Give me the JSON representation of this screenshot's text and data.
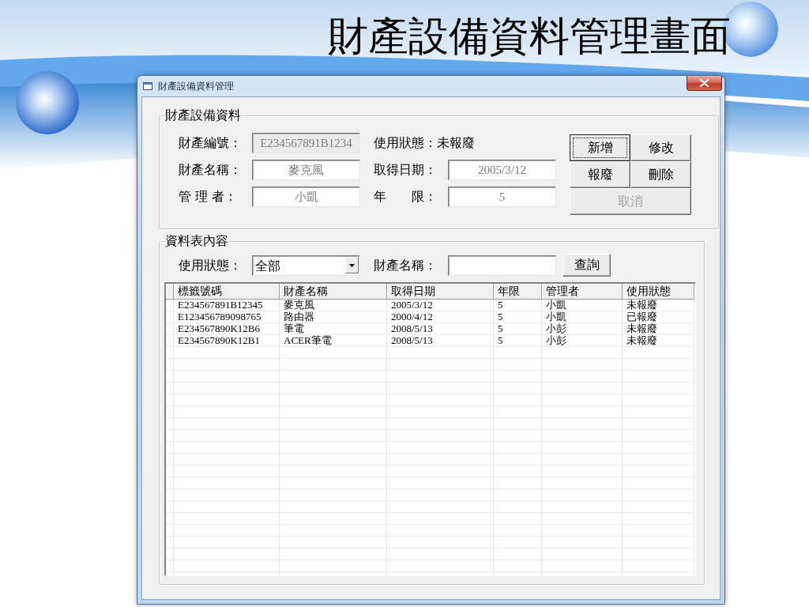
{
  "slide": {
    "title": "財產設備資料管理畫面"
  },
  "window": {
    "title": "財產設備資料管理"
  },
  "detail_group": {
    "title": "財產設備資料",
    "fields": [
      {
        "kind": "input",
        "label": "財產編號：",
        "value": "E234567891B1234",
        "disabled": true
      },
      {
        "kind": "text",
        "label": "使用狀態：",
        "value": "未報廢"
      },
      {
        "kind": "input",
        "label": "財產名稱：",
        "value": "麥克風",
        "disabled": false
      },
      {
        "kind": "input",
        "label": "取得日期：",
        "value": "2005/3/12",
        "disabled": false
      },
      {
        "kind": "input",
        "label": "管 理 者：",
        "value": "小凱",
        "disabled": false
      },
      {
        "kind": "input",
        "label": "年　　限：",
        "value": "5",
        "disabled": false
      }
    ],
    "buttons": [
      {
        "label": "新增",
        "focused": true,
        "disabled": false
      },
      {
        "label": "修改",
        "focused": false,
        "disabled": false
      },
      {
        "label": "報廢",
        "focused": false,
        "disabled": false
      },
      {
        "label": "刪除",
        "focused": false,
        "disabled": false
      },
      {
        "label": "取消",
        "focused": false,
        "disabled": true
      }
    ]
  },
  "table_group": {
    "title": "資料表內容",
    "filter": {
      "status_label": "使用狀態：",
      "status_value": "全部",
      "name_label": "財產名稱：",
      "search_button": "查詢"
    },
    "table": {
      "columns": [
        "標籤號碼",
        "財產名稱",
        "取得日期",
        "年限",
        "管理者",
        "使用狀態"
      ],
      "rows": [
        [
          "E234567891B12345",
          "麥克風",
          "2005/3/12",
          "5",
          "小凱",
          "未報廢"
        ],
        [
          "E123456789098765",
          "路由器",
          "2000/4/12",
          "5",
          "小凱",
          "已報廢"
        ],
        [
          "E234567890K12B6",
          "筆電",
          "2008/5/13",
          "5",
          "小彭",
          "未報廢"
        ],
        [
          "E234567890K12B1",
          "ACER筆電",
          "2008/5/13",
          "5",
          "小彭",
          "未報廢"
        ]
      ]
    }
  }
}
